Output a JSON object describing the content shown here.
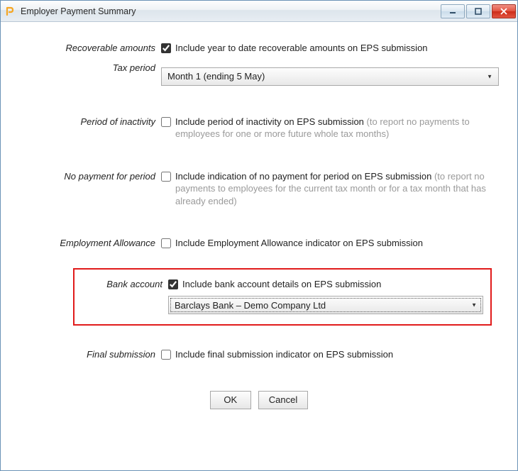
{
  "window": {
    "title": "Employer Payment Summary"
  },
  "form": {
    "recoverable": {
      "label": "Recoverable amounts",
      "checkbox_text": "Include year to date recoverable amounts on EPS submission",
      "checked": true
    },
    "tax_period": {
      "label": "Tax period",
      "selected": "Month 1 (ending 5 May)"
    },
    "inactivity": {
      "label": "Period of inactivity",
      "checkbox_text": "Include period of inactivity on EPS submission ",
      "hint": "(to report no payments to employees for one or more future whole tax months)",
      "checked": false
    },
    "no_payment": {
      "label": "No payment for period",
      "checkbox_text": "Include indication of no payment for period on EPS submission ",
      "hint": "(to report no payments to employees for the current tax month or for a tax month that has already ended)",
      "checked": false
    },
    "emp_allowance": {
      "label": "Employment Allowance",
      "checkbox_text": "Include Employment Allowance indicator on EPS submission",
      "checked": false
    },
    "bank_account": {
      "label": "Bank account",
      "checkbox_text": "Include bank account details on EPS submission",
      "checked": true,
      "selected": "Barclays Bank – Demo Company Ltd"
    },
    "final_submission": {
      "label": "Final submission",
      "checkbox_text": "Include final submission indicator on EPS submission",
      "checked": false
    }
  },
  "buttons": {
    "ok": "OK",
    "cancel": "Cancel"
  }
}
